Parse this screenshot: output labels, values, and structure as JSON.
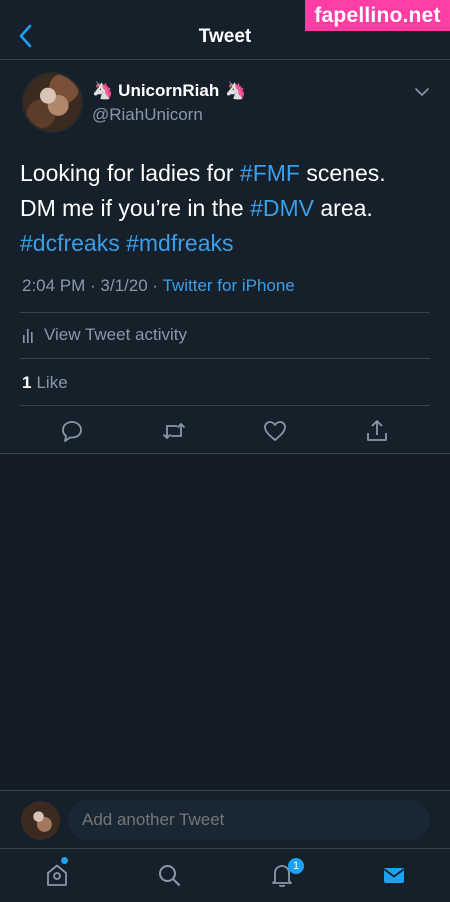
{
  "watermark": "fapellino.net",
  "header": {
    "title": "Tweet"
  },
  "tweet": {
    "display_name": "UnicornRiah",
    "name_emoji": "🦄",
    "handle": "@RiahUnicorn",
    "text_parts": {
      "p1": "Looking for ladies for ",
      "tag1": "#FMF",
      "p2": " scenes.",
      "p3": "DM me if you’re in the ",
      "tag2": "#DMV",
      "p4": " area.",
      "tag3": "#dcfreaks",
      "tag4": "#mdfreaks"
    },
    "time": "2:04 PM",
    "date": "3/1/20",
    "source": "Twitter for iPhone",
    "activity_label": "View Tweet activity",
    "like_count": "1",
    "like_label": "Like"
  },
  "compose": {
    "placeholder": "Add another Tweet"
  },
  "tabbar": {
    "notifications_badge": "1"
  },
  "colors": {
    "accent": "#1da1f2",
    "link": "#3a9ee8",
    "bg": "#15202b",
    "muted": "#8899a6"
  },
  "icons": [
    "back-arrow-icon",
    "chevron-down-icon",
    "bar-chart-icon",
    "reply-icon",
    "retweet-icon",
    "like-icon",
    "share-icon",
    "home-icon",
    "search-icon",
    "notifications-icon",
    "messages-icon"
  ]
}
